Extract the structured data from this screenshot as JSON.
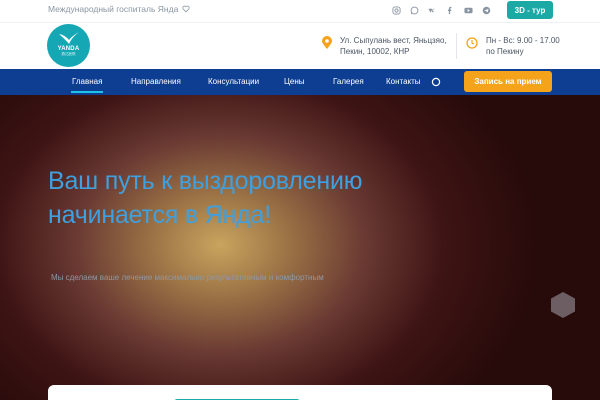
{
  "topbar": {
    "site_name": "Международный госпиталь Янда",
    "socials": [
      "instagram-icon",
      "whatsapp-icon",
      "vk-icon",
      "facebook-icon",
      "youtube-icon",
      "telegram-icon"
    ],
    "tour_button": "3D - тур"
  },
  "header": {
    "logo_text": "YANDA",
    "logo_subtext": "燕达医院",
    "address_lines": [
      "Ул. Сыпулань вест, Яньцзяо,",
      "Пекин, 10002, КНР"
    ],
    "hours_lines": [
      "Пн - Вс: 9.00 - 17.00",
      "по Пекину"
    ]
  },
  "nav": {
    "items": [
      "Главная",
      "Направления",
      "Консультации",
      "Цены",
      "Галерея",
      "Контакты"
    ],
    "active_index": 0,
    "cta_label": "Запись на прием"
  },
  "hero": {
    "title_line1": "Ваш путь к выздоровлению",
    "title_line2": "начинается в Янда!",
    "subtitle": "Мы сделаем ваше лечение максимально результативным и комфортным"
  },
  "colors": {
    "brand_teal": "#1aa9a4",
    "nav_blue": "#0d3e92",
    "cta_orange": "#f5a31a",
    "hero_title": "#3ea0df"
  }
}
